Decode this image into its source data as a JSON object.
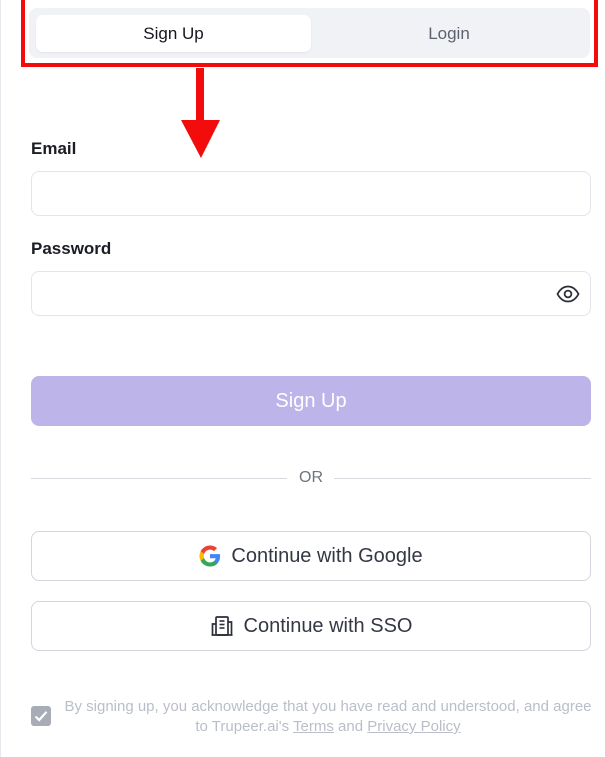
{
  "tabs": [
    {
      "label": "Sign Up",
      "active": true
    },
    {
      "label": "Login",
      "active": false
    }
  ],
  "form": {
    "email_label": "Email",
    "email_value": "",
    "email_placeholder": "",
    "password_label": "Password",
    "password_value": "",
    "password_placeholder": "",
    "password_toggle_icon": "eye-icon",
    "submit_label": "Sign Up"
  },
  "divider_text": "OR",
  "oauth": {
    "google_label": "Continue with Google",
    "google_icon": "google-icon",
    "sso_label": "Continue with SSO",
    "sso_icon": "building-icon"
  },
  "consent": {
    "checked": true,
    "text_before": "By signing up, you acknowledge that you have read and understood, and agree to Trupeer.ai's ",
    "terms_link": "Terms",
    "text_middle": " and ",
    "privacy_link": "Privacy Policy"
  },
  "colors": {
    "annotation": "#f20c0c",
    "primary_disabled": "#bdb5ea",
    "tab_track": "#f1f2f6"
  }
}
